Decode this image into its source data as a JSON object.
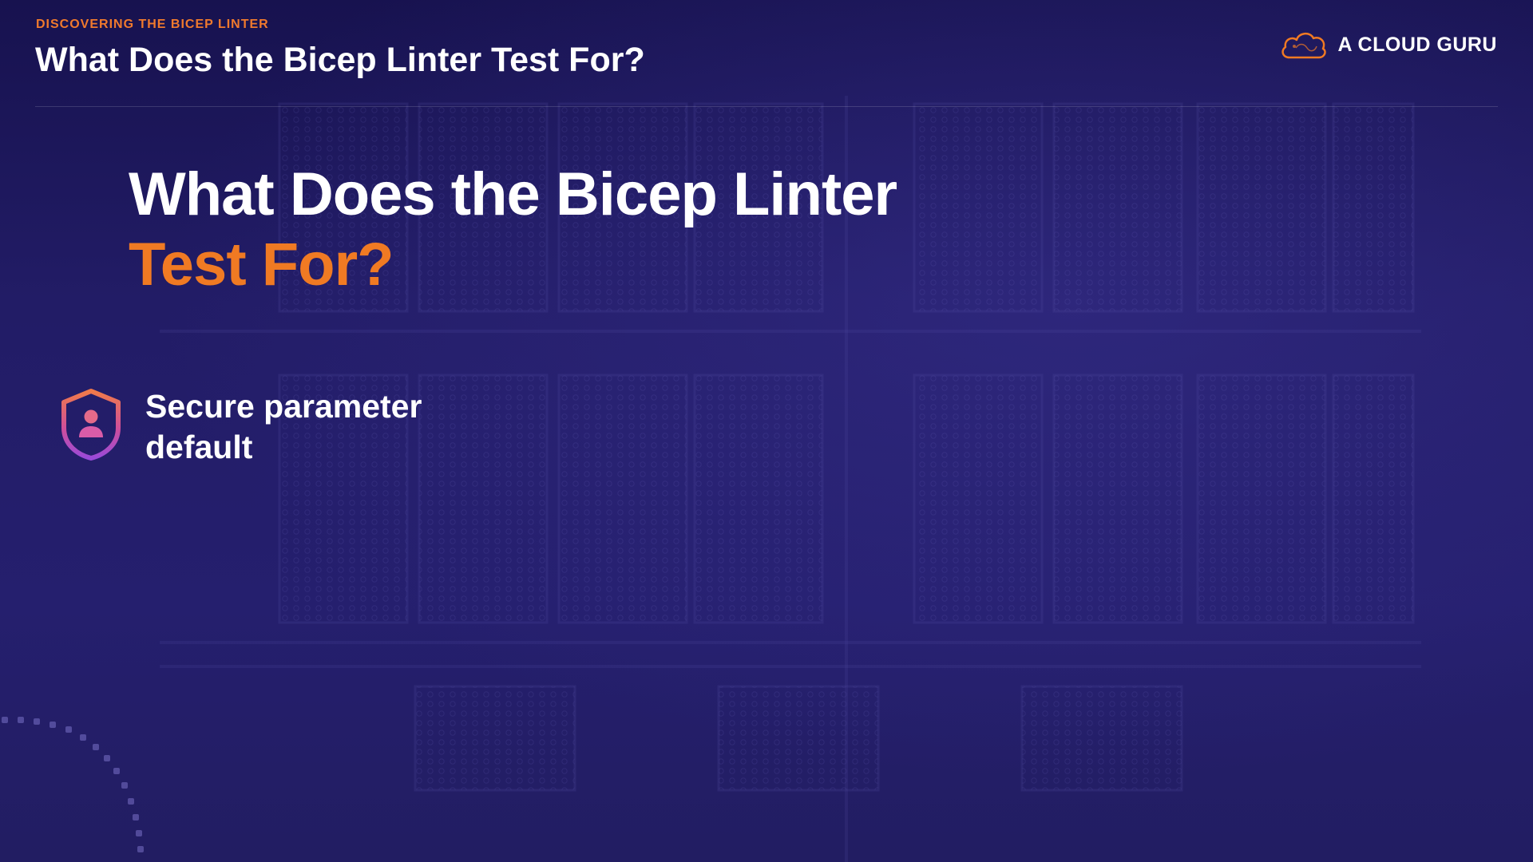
{
  "header": {
    "eyebrow": "DISCOVERING THE BICEP LINTER",
    "title": "What Does the Bicep Linter Test For?"
  },
  "brand": {
    "name": "A CLOUD GURU",
    "icon": "cloud-logo-icon",
    "accent_color": "#f07a23"
  },
  "slide": {
    "title_line1": "What Does the Bicep Linter",
    "title_line2": "Test For?",
    "bullets": [
      {
        "icon": "shield-user-icon",
        "text": "Secure parameter default"
      }
    ]
  },
  "colors": {
    "background": "#1e1a5c",
    "accent": "#f07a23",
    "text": "#ffffff"
  }
}
